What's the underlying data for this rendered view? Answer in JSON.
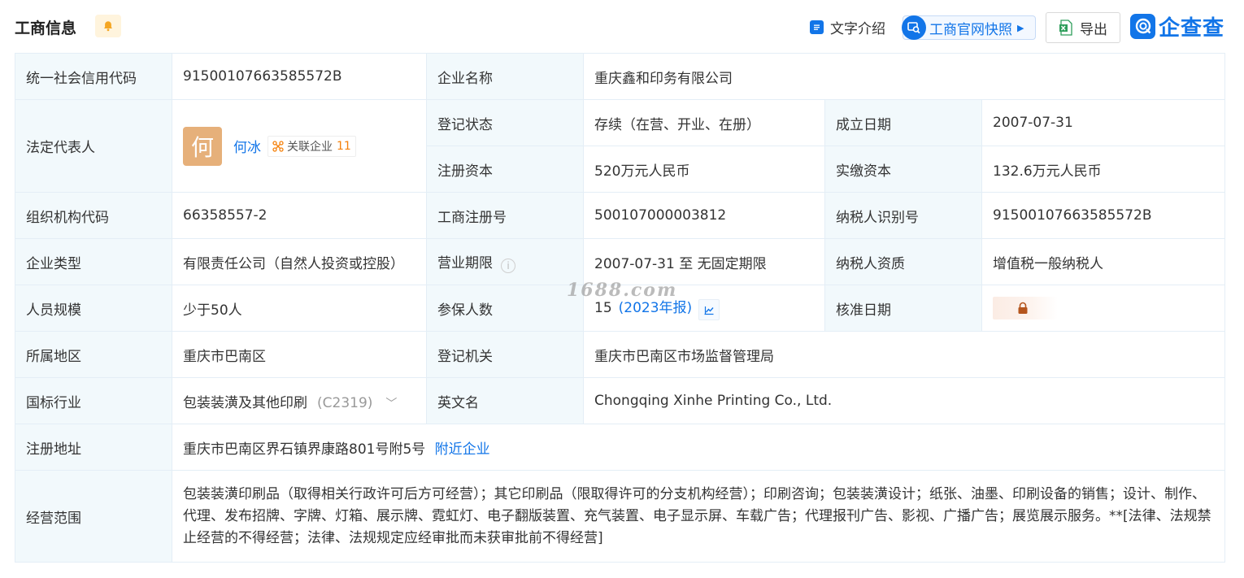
{
  "header": {
    "title": "工商信息",
    "text_intro": "文字介绍",
    "snapshot": "工商官网快照",
    "export": "导出",
    "brand": "企查查"
  },
  "rows": {
    "credit_code": {
      "label": "统一社会信用代码",
      "value": "91500107663585572B"
    },
    "company_name": {
      "label": "企业名称",
      "value": "重庆鑫和印务有限公司"
    },
    "legal_rep": {
      "label": "法定代表人",
      "avatar_char": "何",
      "name": "何冰",
      "related_label": "关联企业",
      "related_count": "11"
    },
    "reg_status": {
      "label": "登记状态",
      "value": "存续（在营、开业、在册）"
    },
    "established": {
      "label": "成立日期",
      "value": "2007-07-31"
    },
    "reg_capital": {
      "label": "注册资本",
      "value": "520万元人民币"
    },
    "paid_capital": {
      "label": "实缴资本",
      "value": "132.6万元人民币"
    },
    "org_code": {
      "label": "组织机构代码",
      "value": "66358557-2"
    },
    "reg_no": {
      "label": "工商注册号",
      "value": "500107000003812"
    },
    "tax_id": {
      "label": "纳税人识别号",
      "value": "91500107663585572B"
    },
    "company_type": {
      "label": "企业类型",
      "value": "有限责任公司（自然人投资或控股）"
    },
    "business_term": {
      "label": "营业期限",
      "value": "2007-07-31 至 无固定期限"
    },
    "taxpayer_qual": {
      "label": "纳税人资质",
      "value": "增值税一般纳税人"
    },
    "staff_size": {
      "label": "人员规模",
      "value": "少于50人"
    },
    "insured": {
      "label": "参保人数",
      "value": "15",
      "year": "(2023年报)"
    },
    "approval_date": {
      "label": "核准日期"
    },
    "region": {
      "label": "所属地区",
      "value": "重庆市巴南区"
    },
    "reg_authority": {
      "label": "登记机关",
      "value": "重庆市巴南区市场监督管理局"
    },
    "industry": {
      "label": "国标行业",
      "value": "包装装潢及其他印刷",
      "code": "(C2319)"
    },
    "english_name": {
      "label": "英文名",
      "value": "Chongqing Xinhe Printing Co., Ltd."
    },
    "address": {
      "label": "注册地址",
      "value": "重庆市巴南区界石镇界康路801号附5号",
      "nearby": "附近企业"
    },
    "scope": {
      "label": "经营范围",
      "value": "包装装潢印刷品（取得相关行政许可后方可经营）；其它印刷品（限取得许可的分支机构经营）；印刷咨询；包装装潢设计；纸张、油墨、印刷设备的销售；设计、制作、代理、发布招牌、字牌、灯箱、展示牌、霓虹灯、电子翻版装置、充气装置、电子显示屏、车载广告；代理报刊广告、影视、广播广告；展览展示服务。**[法律、法规禁止经营的不得经营；法律、法规规定应经审批而未获审批前不得经营]"
    }
  },
  "watermark": "1688.com",
  "colors": {
    "accent": "#1275e8",
    "label_bg": "#f2f9fc",
    "border": "#e4eef6",
    "avatar": "#e6b07a",
    "count": "#f5800a"
  }
}
